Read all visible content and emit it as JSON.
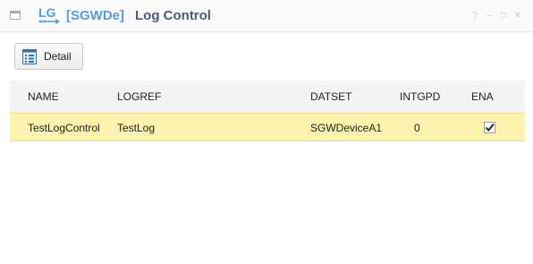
{
  "window": {
    "logo_text": "LG",
    "tag": "[SGWDe]",
    "title": "Log Control",
    "help_glyph": "?",
    "minimize_glyph": "–",
    "maximize_glyph": "□",
    "close_glyph": "✕"
  },
  "toolbar": {
    "detail_label": "Detail"
  },
  "table": {
    "columns": [
      "NAME",
      "LOGREF",
      "DATSET",
      "INTGPD",
      "ENA"
    ],
    "rows": [
      {
        "name": "TestLogControl",
        "logref": "TestLog",
        "datset": "SGWDeviceA1",
        "intgpd": "0",
        "ena": true
      }
    ]
  },
  "colors": {
    "accent": "#5b9bd5",
    "title": "#4a5a78",
    "selected_row": "#fbf2ad",
    "header_bg": "#f3f3f3"
  }
}
